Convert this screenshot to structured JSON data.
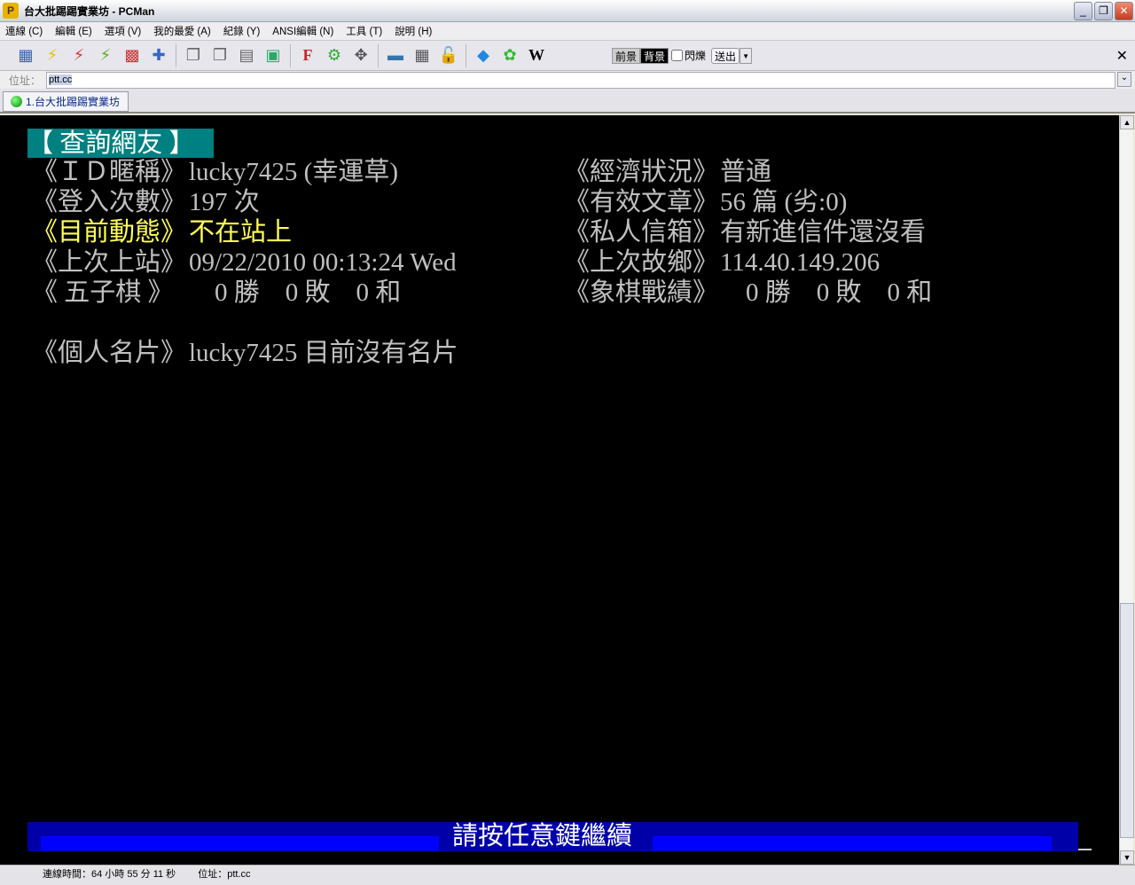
{
  "window": {
    "title": "台大批踢踢實業坊 - PCMan",
    "app_icon": "pcman-logo-icon"
  },
  "menu": [
    "連線 (C)",
    "編輯 (E)",
    "選項 (V)",
    "我的最愛 (A)",
    "紀錄 (Y)",
    "ANSI編輯 (N)",
    "工具 (T)",
    "說明 (H)"
  ],
  "toolbar": {
    "fg": "前景",
    "bg": "背景",
    "blink": "閃爍",
    "send": "送出",
    "close": "✕"
  },
  "address": {
    "label": "位址：",
    "value": "ptt.cc"
  },
  "tabs": [
    {
      "label": "1.台大批踢踢實業坊"
    }
  ],
  "terminal": {
    "header": "【 查詢網友 】",
    "id_label": "《ＩＤ暱稱》",
    "id_value": "lucky7425 (幸運草)",
    "econ_label": "《經濟狀況》",
    "econ_value": "普通",
    "login_label": "《登入次數》",
    "login_value": "197 次",
    "posts_label": "《有效文章》",
    "posts_value": "56 篇 (劣:0)",
    "status_label": "《目前動態》",
    "status_value": "不在站上",
    "mail_label": "《私人信箱》",
    "mail_value": "有新進信件還沒看",
    "last_label": "《上次上站》",
    "last_value": "09/22/2010 00:13:24 Wed",
    "ip_label": "《上次故鄉》",
    "ip_value": "114.40.149.206",
    "gomoku_label": "《 五子棋 》",
    "gomoku_value": "    0 勝    0 敗    0 和",
    "chess_label": "《象棋戰績》",
    "chess_value": "    0 勝    0 敗    0 和",
    "card_label": "《個人名片》",
    "card_value": "lucky7425 目前沒有名片",
    "prompt": "請按任意鍵繼續"
  },
  "status": {
    "time": "連線時間：64 小時 55 分 11 秒",
    "address": "位址：ptt.cc"
  }
}
